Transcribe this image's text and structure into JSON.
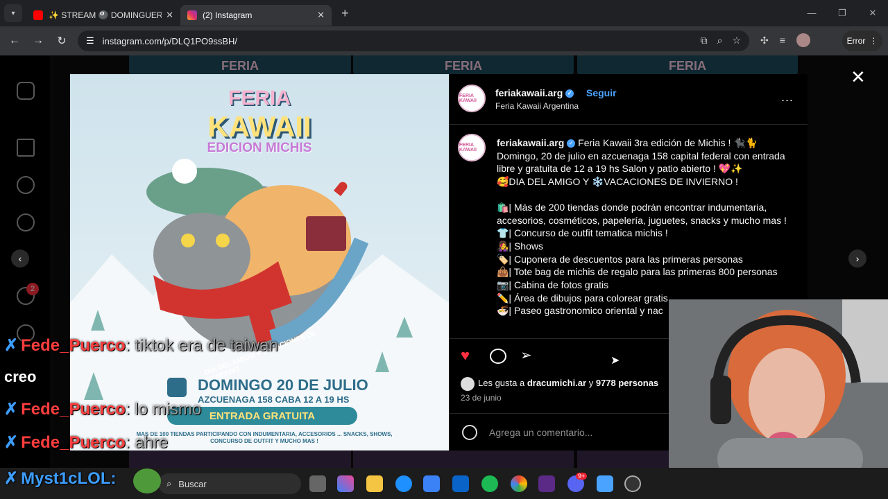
{
  "browser": {
    "tabs": [
      {
        "label": "✨ STREAM 🎱 DOMINGUERO",
        "favicon_color": "#ff0000"
      },
      {
        "label": "(2) Instagram",
        "favicon_color": "#e1306c"
      }
    ],
    "url": "instagram.com/p/DLQ1PO9ssBH/",
    "error_label": "Error"
  },
  "post": {
    "poster_image": {
      "title_top": "FERIA",
      "title_main": "KAWAII",
      "subtitle": "EDICION MICHIS",
      "ribbon_text": "DIA DEL AMIGO ♥ VACACIONES DE INVIERNO",
      "date_line": "DOMINGO 20 DE JULIO",
      "address_line": "AZCUENAGA 158 CABA 12 A 19 HS",
      "entry_label": "ENTRADA GRATUITA",
      "footer_text": "MAS DE 100 TIENDAS PARTICIPANDO CON INDUMENTARIA, ACCESORIOS ... SNACKS, SHOWS, CONCURSO DE OUTFIT Y MUCHO MAS !"
    },
    "header": {
      "username": "feriakawaii.arg",
      "follow_label": "Seguir",
      "subtitle": "Feria Kawaii Argentina",
      "more_label": "..."
    },
    "caption": {
      "username": "feriakawaii.arg",
      "lines": [
        "Feria Kawaii 3ra edición de Michis ! 🐈‍⬛🐈",
        "Domingo, 20 de julio en azcuenaga 158 capital federal con entrada libre y gratuita de 12 a 19 hs Salon y patio abierto ! 💖✨",
        "🥰DIA DEL AMIGO Y ❄️VACACIONES DE INVIERNO !",
        "",
        "🛍️| Más de 200 tiendas donde podrán encontrar indumentaria, accesorios, cosméticos, papelería, juguetes, snacks y mucho mas !",
        "👕| Concurso de outfit tematica michis !",
        "👩‍🎤| Shows",
        "🏷️| Cuponera de descuentos para las primeras personas",
        "👜| Tote bag de michis de regalo para las primeras 800 personas",
        "📷| Cabina de fotos gratis",
        "✏️| Área de dibujos para colorear gratis",
        "🍜| Paseo gastronomico oriental y nac"
      ]
    },
    "likes": {
      "prefix": "Les gusta a ",
      "user": "dracumichi.ar",
      "middle": " y ",
      "count": "9778 personas"
    },
    "date": "23 de junio",
    "comment_placeholder": "Agrega un comentario..."
  },
  "overlay": {
    "chat": [
      {
        "user": "Fede_Puerco",
        "sep": ": ",
        "msg": "tiktok era de taiwan"
      },
      {
        "user": "",
        "sep": "",
        "msg": "creo"
      },
      {
        "user": "Fede_Puerco",
        "sep": ": ",
        "msg": "lo mismo"
      },
      {
        "user": "Fede_Puerco",
        "sep": ": ",
        "msg": "ahre"
      },
      {
        "user": "Myst1cLOL",
        "sep": ":",
        "msg": ""
      }
    ]
  },
  "sidebar": {
    "notification_count": "2"
  },
  "taskbar": {
    "search_label": "Buscar",
    "badge": "9+"
  },
  "colors": {
    "like": "#ff3040",
    "link": "#4aa3ff",
    "accent": "#e1306c"
  }
}
